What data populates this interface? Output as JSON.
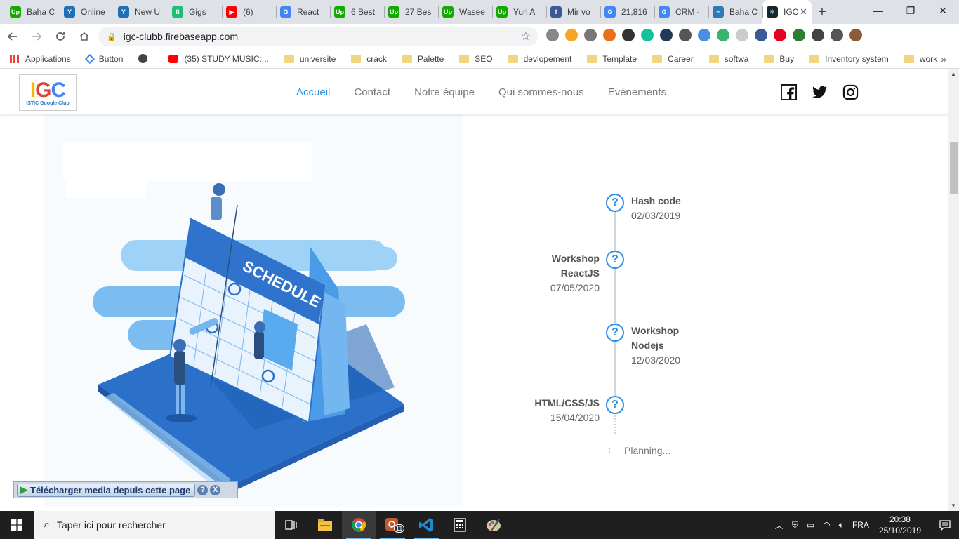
{
  "browser": {
    "tabs": [
      {
        "label": "Baha C",
        "fav_color": "#14a800",
        "fav_text": "Up"
      },
      {
        "label": "Online",
        "fav_color": "#1f6fb8",
        "fav_text": "Y"
      },
      {
        "label": "New U",
        "fav_color": "#1f6fb8",
        "fav_text": "Y"
      },
      {
        "label": "Gigs",
        "fav_color": "#1dbf73",
        "fav_text": "fi"
      },
      {
        "label": "(6)",
        "fav_color": "#ff0000",
        "fav_text": "▶"
      },
      {
        "label": "React",
        "fav_color": "#4285f4",
        "fav_text": "G"
      },
      {
        "label": "6 Best",
        "fav_color": "#14a800",
        "fav_text": "Up"
      },
      {
        "label": "27 Bes",
        "fav_color": "#14a800",
        "fav_text": "Up"
      },
      {
        "label": "Wasee",
        "fav_color": "#14a800",
        "fav_text": "Up"
      },
      {
        "label": "Yuri A",
        "fav_color": "#14a800",
        "fav_text": "Up"
      },
      {
        "label": "Mir vo",
        "fav_color": "#3b5998",
        "fav_text": "f"
      },
      {
        "label": "21,816",
        "fav_color": "#4285f4",
        "fav_text": "G"
      },
      {
        "label": "CRM -",
        "fav_color": "#4285f4",
        "fav_text": "G"
      },
      {
        "label": "Baha C",
        "fav_color": "#2b7bb9",
        "fav_text": "~"
      }
    ],
    "active_tab": {
      "label": "IGC",
      "fav_color": "#20232a",
      "fav_text": "⚛"
    },
    "new_tab_symbol": "+",
    "window_controls": {
      "minimize": "—",
      "restore": "❐",
      "close": "✕"
    },
    "url": "igc-clubb.firebaseapp.com",
    "extension_colors": [
      "#888",
      "#f6a623",
      "#777",
      "#e8711c",
      "#333",
      "#15c39a",
      "#23395b",
      "#555",
      "#4a90e2",
      "#3cb371",
      "#ccc",
      "#3b5998",
      "#e60023",
      "#2e7d32",
      "#444",
      "#555",
      "#8d5a3b"
    ],
    "bookmarks": [
      {
        "label": "Applications",
        "type": "apps"
      },
      {
        "label": "Button",
        "type": "link"
      },
      {
        "label": "",
        "type": "globe"
      },
      {
        "label": "(35) STUDY MUSIC:...",
        "type": "youtube"
      },
      {
        "label": "universite",
        "type": "folder"
      },
      {
        "label": "crack",
        "type": "folder"
      },
      {
        "label": "Palette",
        "type": "folder"
      },
      {
        "label": "SEO",
        "type": "folder"
      },
      {
        "label": "devlopement",
        "type": "folder"
      },
      {
        "label": "Template",
        "type": "folder"
      },
      {
        "label": "Career",
        "type": "folder"
      },
      {
        "label": "softwa",
        "type": "folder"
      },
      {
        "label": "Buy",
        "type": "folder"
      },
      {
        "label": "Inventory system",
        "type": "folder"
      },
      {
        "label": "work",
        "type": "folder"
      }
    ],
    "bookmarks_more": "»"
  },
  "site": {
    "logo_text": "IGC",
    "logo_subtext": "ISTIC Google Club",
    "nav": [
      {
        "label": "Accueil",
        "active": true
      },
      {
        "label": "Contact",
        "active": false
      },
      {
        "label": "Notre équipe",
        "active": false
      },
      {
        "label": "Qui sommes-nous",
        "active": false
      },
      {
        "label": "Evénements",
        "active": false
      }
    ],
    "social": [
      "facebook-icon",
      "twitter-icon",
      "instagram-icon"
    ],
    "illustration_text": "SCHEDULE",
    "timeline": [
      {
        "title": "Hash code",
        "date": "02/03/2019",
        "side": "right"
      },
      {
        "title": "Workshop ReactJS",
        "date": "07/05/2020",
        "side": "left"
      },
      {
        "title": "Workshop Nodejs",
        "date": "12/03/2020",
        "side": "right"
      },
      {
        "title": "HTML/CSS/JS",
        "date": "15/04/2020",
        "side": "left"
      }
    ],
    "timeline_icon": "?",
    "planning": "Planning..."
  },
  "download_bar": {
    "label": "Télécharger media depuis cette page",
    "help": "?",
    "close": "X"
  },
  "taskbar": {
    "search_placeholder": "Taper ici pour rechercher",
    "badge": "11",
    "language": "FRA",
    "time": "20:38",
    "date": "25/10/2019"
  }
}
